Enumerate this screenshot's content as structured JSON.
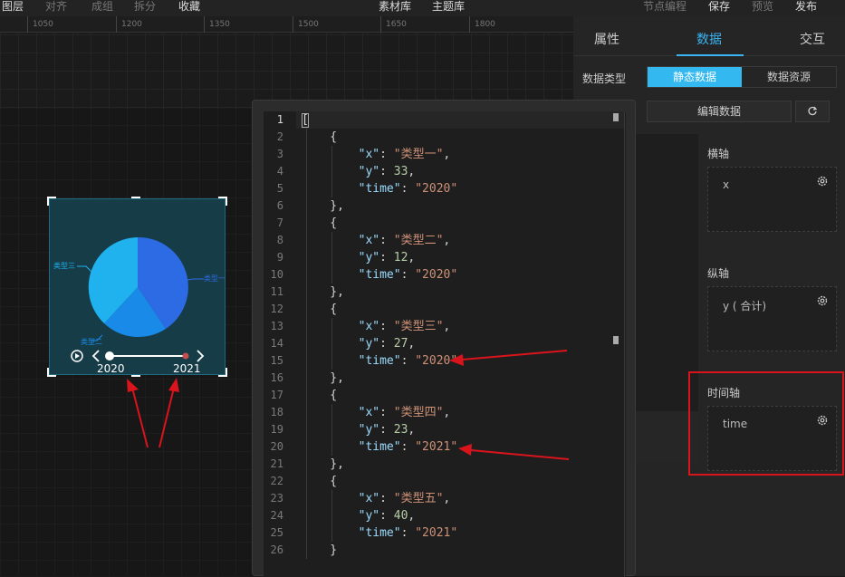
{
  "topbar": {
    "left_items": [
      "图层",
      "对齐",
      "成组",
      "拆分",
      "收藏"
    ],
    "center_items": [
      "素材库",
      "主题库"
    ],
    "right_items": [
      "节点编程",
      "保存",
      "预览",
      "发布"
    ]
  },
  "ruler": {
    "ticks": [
      "1050",
      "1200",
      "1350",
      "1500",
      "1650",
      "1800"
    ]
  },
  "widget": {
    "pie_labels": [
      "类型三",
      "类型一",
      "类型二"
    ],
    "timeline": [
      "2020",
      "2021"
    ],
    "colors": {
      "slice_a": "#2d6be4",
      "slice_b": "#1fb2ee",
      "slice_c": "#1a8ae9"
    }
  },
  "panel": {
    "tabs": [
      "属性",
      "数据",
      "交互"
    ],
    "data_type_label": "数据类型",
    "segments": [
      "静态数据",
      "数据资源"
    ],
    "edit_button": "编辑数据",
    "fields": [
      {
        "title": "横轴",
        "value": "x"
      },
      {
        "title": "纵轴",
        "value": "y ( 合计)"
      },
      {
        "title": "时间轴",
        "value": "time"
      }
    ]
  },
  "editor": {
    "lines": [
      [
        [
          "p",
          "["
        ]
      ],
      [
        [
          "p",
          "    {"
        ]
      ],
      [
        [
          "k",
          "        \"x\""
        ],
        [
          "p",
          ": "
        ],
        [
          "s",
          "\"类型一\""
        ],
        [
          "p",
          ","
        ]
      ],
      [
        [
          "k",
          "        \"y\""
        ],
        [
          "p",
          ": "
        ],
        [
          "n",
          "33"
        ],
        [
          "p",
          ","
        ]
      ],
      [
        [
          "k",
          "        \"time\""
        ],
        [
          "p",
          ": "
        ],
        [
          "s",
          "\"2020\""
        ]
      ],
      [
        [
          "p",
          "    },"
        ]
      ],
      [
        [
          "p",
          "    {"
        ]
      ],
      [
        [
          "k",
          "        \"x\""
        ],
        [
          "p",
          ": "
        ],
        [
          "s",
          "\"类型二\""
        ],
        [
          "p",
          ","
        ]
      ],
      [
        [
          "k",
          "        \"y\""
        ],
        [
          "p",
          ": "
        ],
        [
          "n",
          "12"
        ],
        [
          "p",
          ","
        ]
      ],
      [
        [
          "k",
          "        \"time\""
        ],
        [
          "p",
          ": "
        ],
        [
          "s",
          "\"2020\""
        ]
      ],
      [
        [
          "p",
          "    },"
        ]
      ],
      [
        [
          "p",
          "    {"
        ]
      ],
      [
        [
          "k",
          "        \"x\""
        ],
        [
          "p",
          ": "
        ],
        [
          "s",
          "\"类型三\""
        ],
        [
          "p",
          ","
        ]
      ],
      [
        [
          "k",
          "        \"y\""
        ],
        [
          "p",
          ": "
        ],
        [
          "n",
          "27"
        ],
        [
          "p",
          ","
        ]
      ],
      [
        [
          "k",
          "        \"time\""
        ],
        [
          "p",
          ": "
        ],
        [
          "s",
          "\"2020\""
        ]
      ],
      [
        [
          "p",
          "    },"
        ]
      ],
      [
        [
          "p",
          "    {"
        ]
      ],
      [
        [
          "k",
          "        \"x\""
        ],
        [
          "p",
          ": "
        ],
        [
          "s",
          "\"类型四\""
        ],
        [
          "p",
          ","
        ]
      ],
      [
        [
          "k",
          "        \"y\""
        ],
        [
          "p",
          ": "
        ],
        [
          "n",
          "23"
        ],
        [
          "p",
          ","
        ]
      ],
      [
        [
          "k",
          "        \"time\""
        ],
        [
          "p",
          ": "
        ],
        [
          "s",
          "\"2021\""
        ]
      ],
      [
        [
          "p",
          "    },"
        ]
      ],
      [
        [
          "p",
          "    {"
        ]
      ],
      [
        [
          "k",
          "        \"x\""
        ],
        [
          "p",
          ": "
        ],
        [
          "s",
          "\"类型五\""
        ],
        [
          "p",
          ","
        ]
      ],
      [
        [
          "k",
          "        \"y\""
        ],
        [
          "p",
          ": "
        ],
        [
          "n",
          "40"
        ],
        [
          "p",
          ","
        ]
      ],
      [
        [
          "k",
          "        \"time\""
        ],
        [
          "p",
          ": "
        ],
        [
          "s",
          "\"2021\""
        ]
      ],
      [
        [
          "p",
          "    }"
        ]
      ]
    ]
  }
}
